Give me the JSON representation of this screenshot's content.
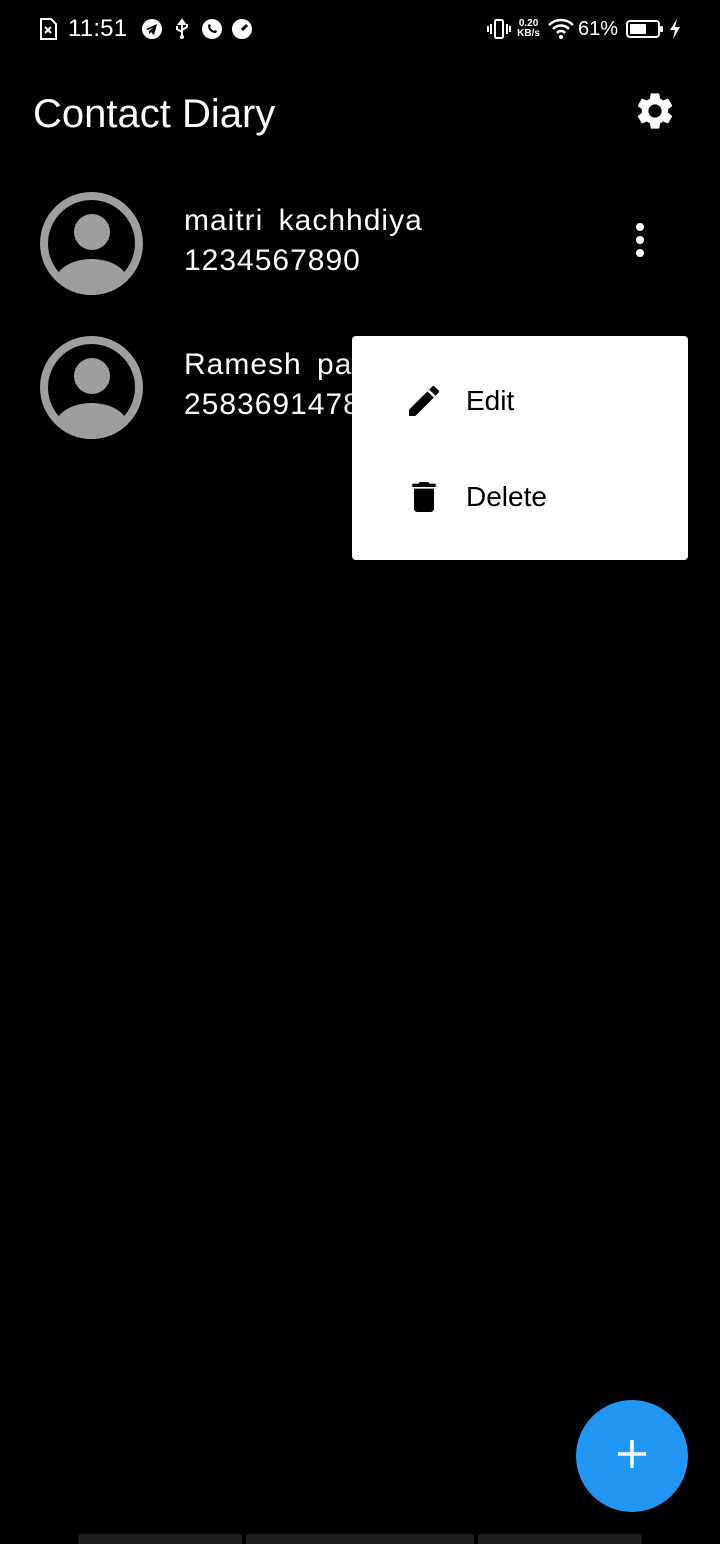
{
  "status_bar": {
    "time": "11:51",
    "left_icons": [
      "sim-off-icon",
      "telegram-icon",
      "usb-icon",
      "whatsapp-icon",
      "speedometer-icon"
    ],
    "net_speed_value": "0.20",
    "net_speed_unit": "KB/s",
    "battery_percent_text": "61%",
    "battery_level": 0.61,
    "right_icons": [
      "vibrate-icon",
      "wifi-icon",
      "battery-icon",
      "charging-icon"
    ]
  },
  "app_bar": {
    "title": "Contact Diary",
    "settings_icon": "gear-icon"
  },
  "contacts": [
    {
      "name": "maitri  kachhdiya",
      "phone": "1234567890"
    },
    {
      "name": "Ramesh  pa",
      "phone": "2583691478"
    }
  ],
  "popup_menu": {
    "items": [
      {
        "label": "Edit",
        "icon": "pencil-icon"
      },
      {
        "label": "Delete",
        "icon": "trash-icon"
      }
    ]
  },
  "fab": {
    "icon": "plus-icon"
  },
  "colors": {
    "background": "#000000",
    "avatar": "#9e9e9e",
    "fab": "#2196f3",
    "menu_bg": "#ffffff"
  }
}
